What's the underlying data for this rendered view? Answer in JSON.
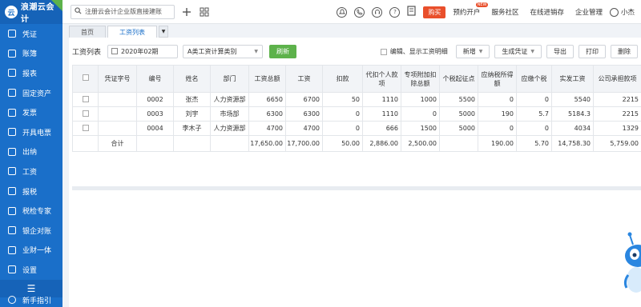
{
  "brand": {
    "name": "浪潮云会计"
  },
  "sidebar": {
    "items": [
      {
        "label": "凭证"
      },
      {
        "label": "账簿"
      },
      {
        "label": "报表"
      },
      {
        "label": "固定资产"
      },
      {
        "label": "发票"
      },
      {
        "label": "开具电票"
      },
      {
        "label": "出纳"
      },
      {
        "label": "工资"
      },
      {
        "label": "报税"
      },
      {
        "label": "税检专家"
      },
      {
        "label": "银企对账"
      },
      {
        "label": "业财一体"
      },
      {
        "label": "设置"
      }
    ],
    "toggle_icon": "☰",
    "help_label": "新手指引"
  },
  "topbar": {
    "search_text": "注册云会计企业版直接建账",
    "buy_label": "购买",
    "links": [
      {
        "label": "预约开户",
        "badge": "NEW"
      },
      {
        "label": "服务社区",
        "badge": ""
      },
      {
        "label": "在线进销存",
        "badge": ""
      },
      {
        "label": "企业管理",
        "badge": ""
      }
    ],
    "user_name": "小杰"
  },
  "tabs": [
    {
      "label": "首页",
      "active": false
    },
    {
      "label": "工资列表",
      "active": true
    }
  ],
  "toolbar": {
    "label": "工资列表",
    "period": "2020年02期",
    "category": "A类工资计算类别",
    "refresh_label": "刷新",
    "edit_option_label": "编辑、显示工资明细",
    "buttons": [
      {
        "label": "新增",
        "dropdown": true
      },
      {
        "label": "生成凭证",
        "dropdown": true
      },
      {
        "label": "导出",
        "dropdown": false
      },
      {
        "label": "打印",
        "dropdown": false
      },
      {
        "label": "删除",
        "dropdown": false
      }
    ]
  },
  "table": {
    "headers": [
      "凭证字号",
      "编号",
      "姓名",
      "部门",
      "工资总额",
      "工资",
      "扣款",
      "代扣个人款项",
      "专项附加扣除总额",
      "个税起征点",
      "应纳税所得额",
      "应缴个税",
      "实发工资",
      "公司承担款项"
    ],
    "rows": [
      [
        "",
        "0002",
        "张杰",
        "人力资源部",
        "6650",
        "6700",
        "50",
        "1110",
        "1000",
        "5500",
        "0",
        "0",
        "5540",
        "2215"
      ],
      [
        "",
        "0003",
        "刘宇",
        "市场部",
        "6300",
        "6300",
        "0",
        "1110",
        "0",
        "5000",
        "190",
        "5.7",
        "5184.3",
        "2215"
      ],
      [
        "",
        "0004",
        "李木子",
        "人力资源部",
        "4700",
        "4700",
        "0",
        "666",
        "1500",
        "5000",
        "0",
        "0",
        "4034",
        "1329"
      ]
    ],
    "total": [
      "合计",
      "",
      "",
      "",
      "17,650.00",
      "17,700.00",
      "50.00",
      "2,886.00",
      "2,500.00",
      "",
      "190.00",
      "5.70",
      "14,758.30",
      "5,759.00"
    ]
  },
  "colors": {
    "sidebar": "#1a6fc9",
    "accent_green": "#5db24b",
    "buy_red": "#e94f2b"
  },
  "icons": [
    "search-icon",
    "plus-icon",
    "grid-icon",
    "bell-icon",
    "phone-icon",
    "headset-icon",
    "help-icon",
    "document-icon",
    "calendar-icon",
    "chevron-down-icon",
    "user-icon"
  ]
}
